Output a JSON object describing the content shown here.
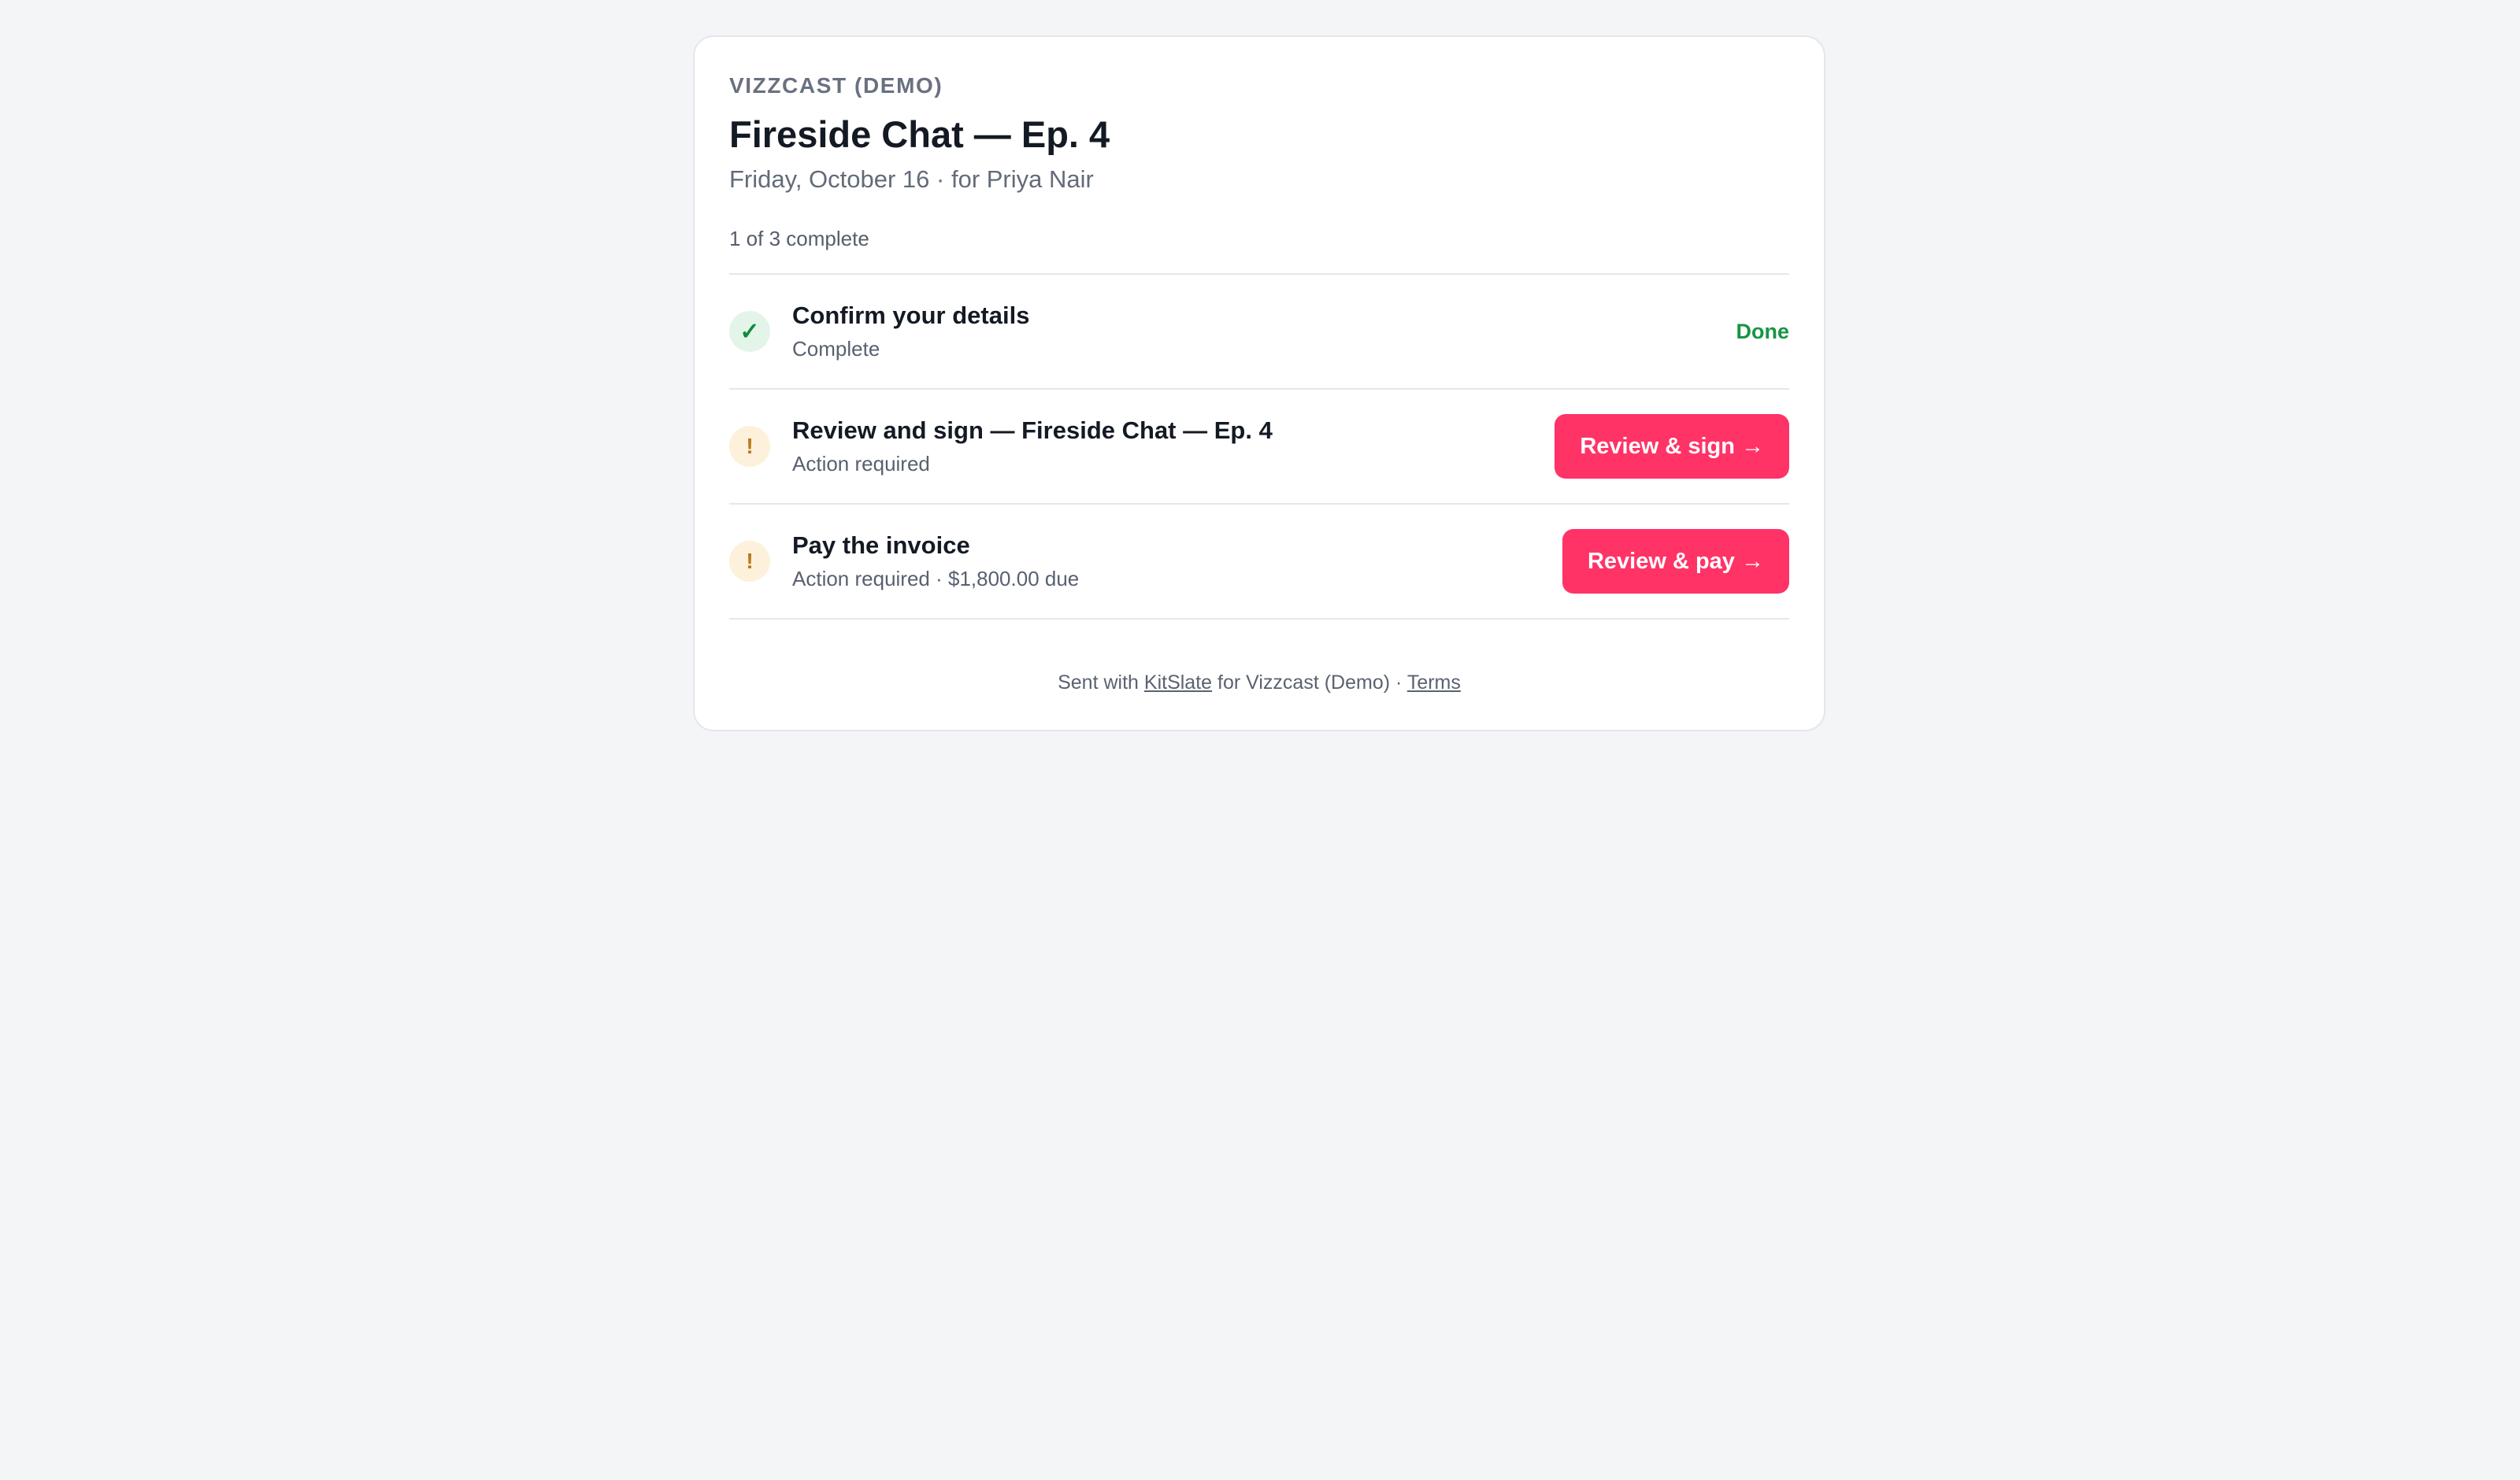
{
  "header": {
    "brand": "VIZZCAST (DEMO)",
    "title": "Fireside Chat — Ep. 4",
    "subtitle": "Friday, October 16 · for Priya Nair",
    "progress_text": "1 of 3 complete"
  },
  "progress": {
    "completed": 1,
    "total": 3
  },
  "tasks": [
    {
      "title": "Confirm your details",
      "subtitle": "Complete",
      "status": "done",
      "status_icon": "check-icon",
      "action_label": "Done"
    },
    {
      "title": "Review and sign — Fireside Chat — Ep. 4",
      "subtitle": "Action required",
      "status": "pending",
      "status_icon": "exclamation-icon",
      "action_label": "Review & sign →"
    },
    {
      "title": "Pay the invoice",
      "subtitle": "Action required · $1,800.00 due",
      "status": "pending",
      "status_icon": "exclamation-icon",
      "action_label": "Review & pay →"
    }
  ],
  "footer": {
    "sent_with": "Sent with",
    "provider_link": "KitSlate",
    "for_text": "for Vizzcast (Demo) ·",
    "terms_link": "Terms"
  },
  "colors": {
    "accent": "#ff3366",
    "done_green": "#189444",
    "pending_amber": "#b8791a",
    "background": "#f4f5f7"
  }
}
